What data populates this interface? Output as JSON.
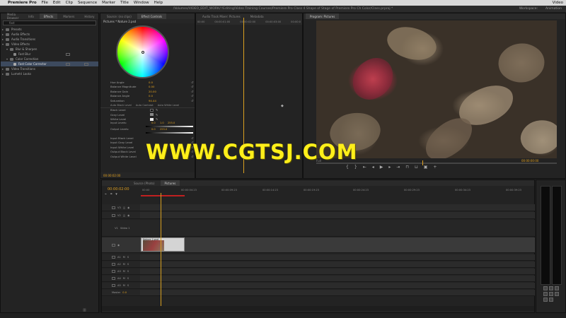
{
  "menubar": {
    "apple": "",
    "app": "Premiere Pro",
    "items": [
      "File",
      "Edit",
      "Clip",
      "Sequence",
      "Marker",
      "Title",
      "Window",
      "Help"
    ],
    "right": [
      "Video"
    ]
  },
  "titlebar": {
    "path": "/Volumes/VIDEO_EDIT_WORK/!!Editing/Video Training Courses/Premiere Pro Class 4 Shape of Stage of Premiere Pro Ch Color/Class.prproj *",
    "workspace_label": "Workspace:",
    "workspace_value": "Animation"
  },
  "effects": {
    "tabs": [
      "Media Browser",
      "Info",
      "Effects",
      "Markers",
      "History"
    ],
    "active_tab": "Effects",
    "search_value": "fast",
    "tree": [
      {
        "label": "Presets",
        "indent": 0
      },
      {
        "label": "Audio Effects",
        "indent": 0
      },
      {
        "label": "Audio Transitions",
        "indent": 0
      },
      {
        "label": "Video Effects",
        "indent": 0
      },
      {
        "label": "Blur & Sharpen",
        "indent": 1
      },
      {
        "label": "Fast Blur",
        "indent": 2
      },
      {
        "label": "Color Correction",
        "indent": 1
      },
      {
        "label": "Fast Color Corrector",
        "indent": 2,
        "selected": true
      },
      {
        "label": "Video Transitions",
        "indent": 0
      },
      {
        "label": "Lumetri Looks",
        "indent": 0
      }
    ]
  },
  "effect_controls": {
    "tabs": [
      "Source: (no clips)",
      "Effect Controls",
      "Audio Track Mixer: Pictures",
      "Metadata"
    ],
    "active_tab": "Effect Controls",
    "header": "Pictures * Nature 2.psd",
    "params": [
      {
        "label": "Hue Angle",
        "value": "0.0"
      },
      {
        "label": "Balance Magnitude",
        "value": "0.00"
      },
      {
        "label": "Balance Gain",
        "value": "20.00"
      },
      {
        "label": "Balance Angle",
        "value": "0.0"
      },
      {
        "label": "Saturation",
        "value": "94.44"
      }
    ],
    "subtabs": [
      "Auto Black Level",
      "Auto Contrast",
      "Auto White Level"
    ],
    "levels": [
      {
        "label": "Black Level"
      },
      {
        "label": "Gray Level"
      },
      {
        "label": "White Level"
      }
    ],
    "input_levels": {
      "label": "Input Levels:",
      "values": [
        "0.0",
        "1.0",
        "255.0"
      ]
    },
    "output_levels": {
      "label": "Output Levels:",
      "values": [
        "0.0",
        "255.0"
      ]
    },
    "extra": [
      "Input Black Level",
      "Input Gray Level",
      "Input White Level",
      "Output Black Level",
      "Output White Level"
    ],
    "timecode": "00:00:02:00",
    "ruler": [
      "00:00",
      "00:00:01:00",
      "00:00:02:00",
      "00:00:03:00",
      "00:00:0"
    ]
  },
  "program": {
    "tab": "Program: Pictures",
    "timecode": "00:00:00:00",
    "fit": "Full"
  },
  "timeline": {
    "tabs": [
      "Source (Photo)",
      "Pictures"
    ],
    "active_tab": "Pictures",
    "timecode": "00:00:02:00",
    "ruler": [
      "00:00",
      "00:00:04:23",
      "00:00:09:23",
      "00:00:14:23",
      "00:00:19:23",
      "00:00:24:23",
      "00:00:29:23",
      "00:00:34:23",
      "00:00:39:23"
    ],
    "video_tracks": [
      "V3",
      "V2",
      "V1"
    ],
    "v1_name": "Video 1",
    "audio_tracks": [
      "A1",
      "A2",
      "A3",
      "A4",
      "A5"
    ],
    "master": {
      "label": "Master",
      "value": "0.0"
    },
    "clip_label": "Nature 2.psd"
  },
  "watermark": "WWW.CGTSJ.COM"
}
